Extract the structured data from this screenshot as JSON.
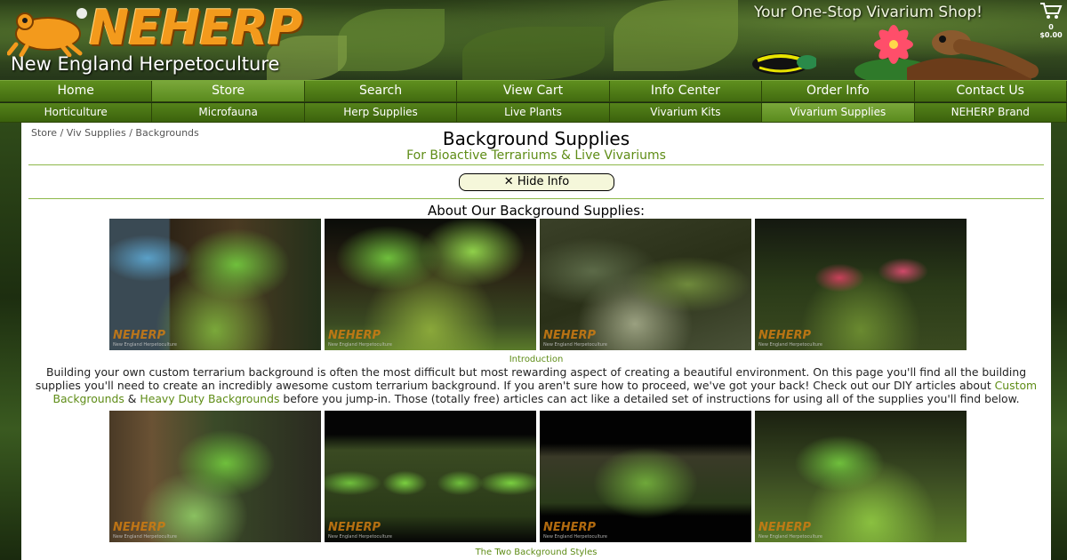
{
  "header": {
    "logo_text": "NEHERP",
    "logo_sub": "New England Herpetoculture",
    "tagline": "Your One-Stop Vivarium Shop!",
    "cart_count": "0",
    "cart_total": "$0.00"
  },
  "nav_main": [
    {
      "label": "Home",
      "active": false
    },
    {
      "label": "Store",
      "active": true
    },
    {
      "label": "Search",
      "active": false
    },
    {
      "label": "View Cart",
      "active": false
    },
    {
      "label": "Info Center",
      "active": false
    },
    {
      "label": "Order Info",
      "active": false
    },
    {
      "label": "Contact Us",
      "active": false
    }
  ],
  "nav_sub": [
    {
      "label": "Horticulture",
      "active": false
    },
    {
      "label": "Microfauna",
      "active": false
    },
    {
      "label": "Herp Supplies",
      "active": false
    },
    {
      "label": "Live Plants",
      "active": false
    },
    {
      "label": "Vivarium Kits",
      "active": false
    },
    {
      "label": "Vivarium Supplies",
      "active": true
    },
    {
      "label": "NEHERP Brand",
      "active": false
    }
  ],
  "breadcrumb": [
    "Store",
    "Viv Supplies",
    "Backgrounds"
  ],
  "breadcrumb_sep": "/",
  "page": {
    "title": "Background Supplies",
    "subtitle": "For Bioactive Terrariums & Live Vivariums",
    "hide_info_icon": "✕",
    "hide_info_label": "Hide Info",
    "section_title": "About Our Background Supplies:",
    "caption_1": "Introduction",
    "intro_part1": "Building your own custom terrarium background is often the most difficult but most rewarding aspect of creating a beautiful environment. On this page you'll find all the building supplies you'll need to create an incredibly awesome custom terrarium background. If you aren't sure how to proceed, we've got your back! Check out our DIY articles about ",
    "intro_link1": "Custom Backgrounds",
    "intro_amp": " & ",
    "intro_link2": "Heavy Duty Backgrounds",
    "intro_part2": " before you jump-in. Those (totally free) articles can act like a detailed set of instructions for using all of the supplies you'll find below.",
    "caption_2": "The Two Background Styles"
  },
  "watermark": {
    "logo": "NEHERP",
    "sub": "New England Herpetoculture"
  },
  "colors": {
    "accent": "#5e8c16",
    "logo_orange": "#f39a1c",
    "nav_green": "#4f7a16"
  }
}
